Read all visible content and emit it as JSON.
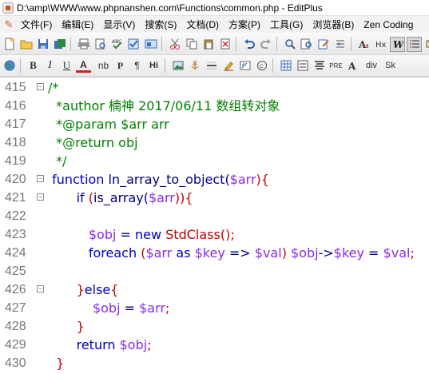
{
  "window": {
    "title": "D:\\amp\\WWW\\www.phpnanshen.com\\Functions\\common.php - EditPlus"
  },
  "menubar": {
    "items": [
      {
        "label": "文件(F)"
      },
      {
        "label": "编辑(E)"
      },
      {
        "label": "显示(V)"
      },
      {
        "label": "搜索(S)"
      },
      {
        "label": "文档(D)"
      },
      {
        "label": "方案(P)"
      },
      {
        "label": "工具(G)"
      },
      {
        "label": "浏览器(B)"
      },
      {
        "label": "Zen Coding"
      }
    ]
  },
  "toolbar2": {
    "b": "B",
    "i": "I",
    "u": "U",
    "a": "A",
    "nb": "nb",
    "p": "P",
    "pilcrow": "¶",
    "hi": "Hi",
    "pre": "PRE",
    "div": "div",
    "sk": "Sk"
  },
  "editor": {
    "lines": [
      {
        "num": "415",
        "fold": "⊟",
        "segments": [
          {
            "t": "/*",
            "c": "comment"
          }
        ]
      },
      {
        "num": "416",
        "fold": "",
        "segments": [
          {
            "t": "  *author 楠神 2017/06/11 数组转对象",
            "c": "comment"
          }
        ]
      },
      {
        "num": "417",
        "fold": "",
        "segments": [
          {
            "t": "  *@param $arr arr",
            "c": "comment"
          }
        ]
      },
      {
        "num": "418",
        "fold": "",
        "segments": [
          {
            "t": "  *@return obj",
            "c": "comment"
          }
        ]
      },
      {
        "num": "419",
        "fold": "",
        "segments": [
          {
            "t": "  */",
            "c": "comment"
          }
        ]
      },
      {
        "num": "420",
        "fold": "⊟",
        "segments": [
          {
            "t": " function ",
            "c": "kw"
          },
          {
            "t": "ln_array_to_object(",
            "c": "plain"
          },
          {
            "t": "$arr",
            "c": "var"
          },
          {
            "t": "){",
            "c": "red"
          }
        ]
      },
      {
        "num": "421",
        "fold": "⊟",
        "segments": [
          {
            "t": "       if ",
            "c": "kw"
          },
          {
            "t": "(",
            "c": "red"
          },
          {
            "t": "is_array(",
            "c": "plain"
          },
          {
            "t": "$arr",
            "c": "var"
          },
          {
            "t": ")){",
            "c": "red"
          }
        ]
      },
      {
        "num": "422",
        "fold": "",
        "segments": [
          {
            "t": "",
            "c": "plain"
          }
        ]
      },
      {
        "num": "423",
        "fold": "",
        "segments": [
          {
            "t": "          $obj",
            "c": "var"
          },
          {
            "t": " = ",
            "c": "plain"
          },
          {
            "t": "new ",
            "c": "kw"
          },
          {
            "t": "StdClass();",
            "c": "red"
          }
        ]
      },
      {
        "num": "424",
        "fold": "",
        "segments": [
          {
            "t": "          foreach ",
            "c": "kw"
          },
          {
            "t": "(",
            "c": "red"
          },
          {
            "t": "$arr",
            "c": "var"
          },
          {
            "t": " as ",
            "c": "kw"
          },
          {
            "t": "$key",
            "c": "var"
          },
          {
            "t": " => ",
            "c": "plain"
          },
          {
            "t": "$val",
            "c": "var"
          },
          {
            "t": ") ",
            "c": "red"
          },
          {
            "t": "$obj",
            "c": "var"
          },
          {
            "t": "->",
            "c": "plain"
          },
          {
            "t": "$key",
            "c": "var"
          },
          {
            "t": " = ",
            "c": "plain"
          },
          {
            "t": "$val",
            "c": "var"
          },
          {
            "t": ";",
            "c": "red"
          }
        ]
      },
      {
        "num": "425",
        "fold": "",
        "segments": [
          {
            "t": "",
            "c": "plain"
          }
        ]
      },
      {
        "num": "426",
        "fold": "⊟",
        "segments": [
          {
            "t": "       }",
            "c": "red"
          },
          {
            "t": "else",
            "c": "kw"
          },
          {
            "t": "{",
            "c": "red"
          }
        ]
      },
      {
        "num": "427",
        "fold": "",
        "segments": [
          {
            "t": "           $obj",
            "c": "var"
          },
          {
            "t": " = ",
            "c": "plain"
          },
          {
            "t": "$arr",
            "c": "var"
          },
          {
            "t": ";",
            "c": "red"
          }
        ]
      },
      {
        "num": "428",
        "fold": "",
        "segments": [
          {
            "t": "       }",
            "c": "red"
          }
        ]
      },
      {
        "num": "429",
        "fold": "",
        "segments": [
          {
            "t": "       return ",
            "c": "kw"
          },
          {
            "t": "$obj",
            "c": "var"
          },
          {
            "t": ";",
            "c": "red"
          }
        ]
      },
      {
        "num": "430",
        "fold": "",
        "segments": [
          {
            "t": "  }",
            "c": "red"
          }
        ]
      }
    ]
  }
}
